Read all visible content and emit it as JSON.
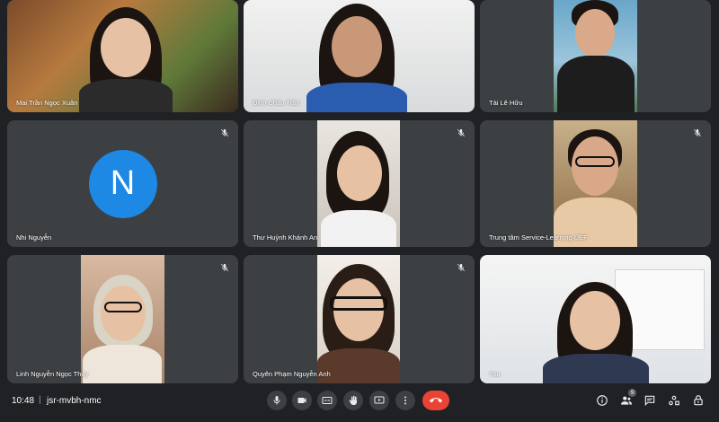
{
  "participants": [
    {
      "name": "Mai Trần Ngọc Xuân"
    },
    {
      "name": "Đinh Châu Trân"
    },
    {
      "name": "Tài Lê Hữu"
    },
    {
      "name": "Nhi Nguyễn",
      "avatar_letter": "N"
    },
    {
      "name": "Thư Huỳnh Khánh An"
    },
    {
      "name": "Trung tâm Service-Learning UEF"
    },
    {
      "name": "Linh Nguyễn Ngọc Thủy"
    },
    {
      "name": "Quyên Phạm Nguyễn Anh"
    },
    {
      "name": "You"
    }
  ],
  "bottom_bar": {
    "time": "10:48",
    "separator": "|",
    "meeting_code": "jsr-mvbh-nmc",
    "people_count": "9"
  },
  "colors": {
    "background": "#202124",
    "tile": "#3c4043",
    "avatar_blue": "#1e88e5",
    "hangup_red": "#ea4335"
  },
  "icons": {
    "mic": "microphone-icon",
    "camera": "camera-icon",
    "captions": "captions-icon",
    "raise_hand": "raise-hand-icon",
    "present": "present-icon",
    "more": "more-options-icon",
    "hangup": "hang-up-icon",
    "info": "info-icon",
    "people": "people-icon",
    "chat": "chat-icon",
    "activities": "activities-icon",
    "host": "host-controls-icon",
    "muted": "mic-off-icon"
  }
}
